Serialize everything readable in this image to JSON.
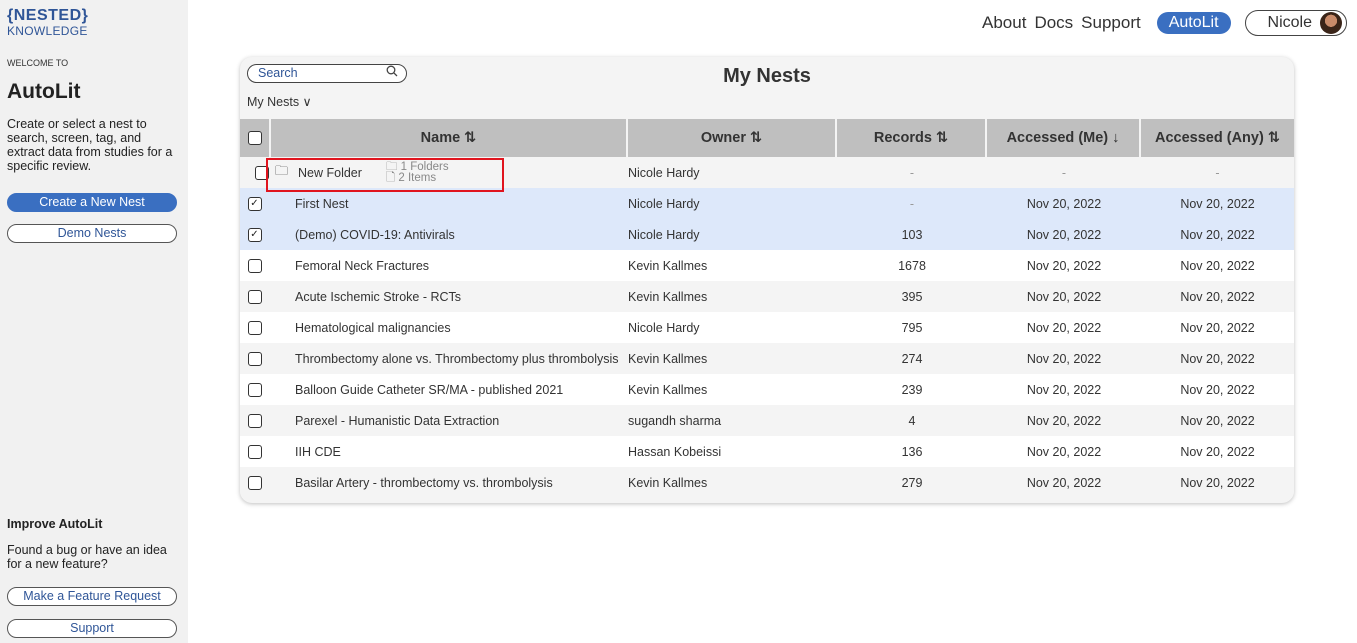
{
  "logo": {
    "top": "{NESTED}",
    "bottom": "KNOWLEDGE"
  },
  "sidebar": {
    "welcome": "WELCOME TO",
    "title": "AutoLit",
    "description": "Create or select a nest to search, screen, tag, and extract data from studies for a specific review.",
    "create_button": "Create a New Nest",
    "demo_button": "Demo Nests",
    "improve_title": "Improve AutoLit",
    "improve_desc": "Found a bug or have an idea for a new feature?",
    "feature_button": "Make a Feature Request",
    "support_button": "Support"
  },
  "nav": {
    "about": "About",
    "docs": "Docs",
    "support": "Support",
    "autolit": "AutoLit",
    "user": "Nicole"
  },
  "card": {
    "title": "My Nests",
    "search_placeholder": "Search",
    "filter": "My Nests ∨",
    "columns": {
      "name": "Name ⇅",
      "owner": "Owner ⇅",
      "records": "Records ⇅",
      "accessed_me": "Accessed (Me) ↓",
      "accessed_any": "Accessed (Any) ⇅"
    },
    "folder": {
      "name": "New Folder",
      "folders": "🗀 1 Folders",
      "items": "🗋 2 Items",
      "owner": "Nicole Hardy",
      "records": "-",
      "accessed_me": "-",
      "accessed_any": "-"
    },
    "rows": [
      {
        "name": "First Nest",
        "owner": "Nicole Hardy",
        "records": "-",
        "accessed_me": "Nov 20, 2022",
        "accessed_any": "Nov 20, 2022",
        "checked": true
      },
      {
        "name": "(Demo) COVID-19: Antivirals",
        "owner": "Nicole Hardy",
        "records": "103",
        "accessed_me": "Nov 20, 2022",
        "accessed_any": "Nov 20, 2022",
        "checked": true
      },
      {
        "name": "Femoral Neck Fractures",
        "owner": "Kevin Kallmes",
        "records": "1678",
        "accessed_me": "Nov 20, 2022",
        "accessed_any": "Nov 20, 2022",
        "checked": false
      },
      {
        "name": "Acute Ischemic Stroke - RCTs",
        "owner": "Kevin Kallmes",
        "records": "395",
        "accessed_me": "Nov 20, 2022",
        "accessed_any": "Nov 20, 2022",
        "checked": false
      },
      {
        "name": "Hematological malignancies",
        "owner": "Nicole Hardy",
        "records": "795",
        "accessed_me": "Nov 20, 2022",
        "accessed_any": "Nov 20, 2022",
        "checked": false
      },
      {
        "name": "Thrombectomy alone vs. Thrombectomy plus thrombolysis",
        "owner": "Kevin Kallmes",
        "records": "274",
        "accessed_me": "Nov 20, 2022",
        "accessed_any": "Nov 20, 2022",
        "checked": false
      },
      {
        "name": "Balloon Guide Catheter SR/MA - published 2021",
        "owner": "Kevin Kallmes",
        "records": "239",
        "accessed_me": "Nov 20, 2022",
        "accessed_any": "Nov 20, 2022",
        "checked": false
      },
      {
        "name": "Parexel - Humanistic Data Extraction",
        "owner": "sugandh sharma",
        "records": "4",
        "accessed_me": "Nov 20, 2022",
        "accessed_any": "Nov 20, 2022",
        "checked": false
      },
      {
        "name": "IIH CDE",
        "owner": "Hassan Kobeissi",
        "records": "136",
        "accessed_me": "Nov 20, 2022",
        "accessed_any": "Nov 20, 2022",
        "checked": false
      },
      {
        "name": "Basilar Artery - thrombectomy vs. thrombolysis",
        "owner": "Kevin Kallmes",
        "records": "279",
        "accessed_me": "Nov 20, 2022",
        "accessed_any": "Nov 20, 2022",
        "checked": false
      }
    ]
  },
  "colors": {
    "accent": "#3a6fc1",
    "selected_row": "#dde8fa",
    "header_bg": "#bfbfbf",
    "highlight": "#e0141e"
  },
  "icons": {
    "search": "search-icon",
    "folder": "folder-icon",
    "checkbox": "checkbox-icon"
  }
}
